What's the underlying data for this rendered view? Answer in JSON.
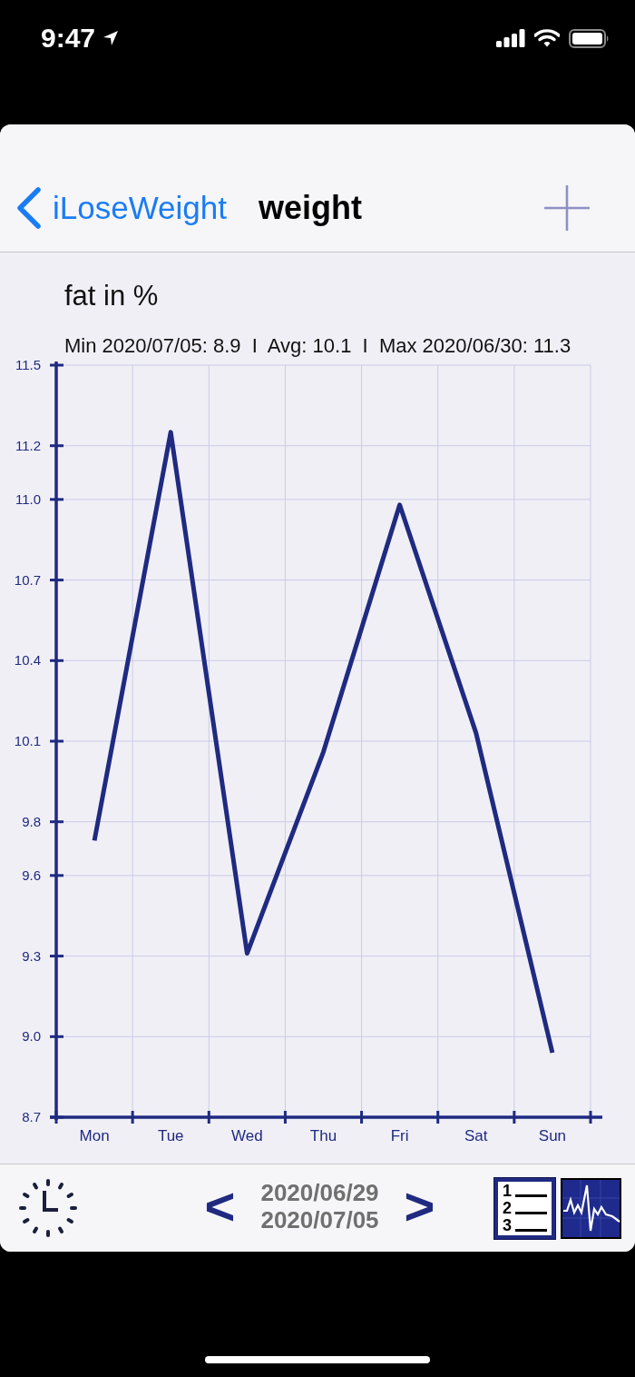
{
  "status_bar": {
    "time": "9:47"
  },
  "nav_bar": {
    "back_label": "iLoseWeight",
    "title": "weight"
  },
  "chart": {
    "stats": "Min 2020/07/05: 8.9  I  Avg: 10.1  I  Max 2020/06/30: 11.3",
    "chart_data": {
      "type": "line",
      "title": "fat in %",
      "grid": true,
      "categories": [
        "Mon",
        "Tue",
        "Wed",
        "Thu",
        "Fri",
        "Sat",
        "Sun"
      ],
      "series": [
        {
          "color": "#1f2a80",
          "values": [
            9.73,
            11.25,
            9.31,
            10.06,
            10.98,
            10.13,
            8.94
          ]
        }
      ],
      "ylim": [
        8.7,
        11.5
      ],
      "yticks": [
        {
          "value": 8.7,
          "label": "8.7"
        },
        {
          "value": 9.0,
          "label": "9.0"
        },
        {
          "value": 9.3,
          "label": "9.3"
        },
        {
          "value": 9.6,
          "label": "9.6"
        },
        {
          "value": 9.8,
          "label": "9.8"
        },
        {
          "value": 10.1,
          "label": "10.1"
        },
        {
          "value": 10.4,
          "label": "10.4"
        },
        {
          "value": 10.7,
          "label": "10.7"
        },
        {
          "value": 11.0,
          "label": "11.0"
        },
        {
          "value": 11.2,
          "label": "11.2"
        },
        {
          "value": 11.5,
          "label": "11.5"
        }
      ]
    }
  },
  "toolbar": {
    "previous": "<",
    "start_date": "2020/06/29",
    "end_date": "2020/07/05",
    "next": ">",
    "list_numbers": [
      "1",
      "2",
      "3"
    ]
  }
}
